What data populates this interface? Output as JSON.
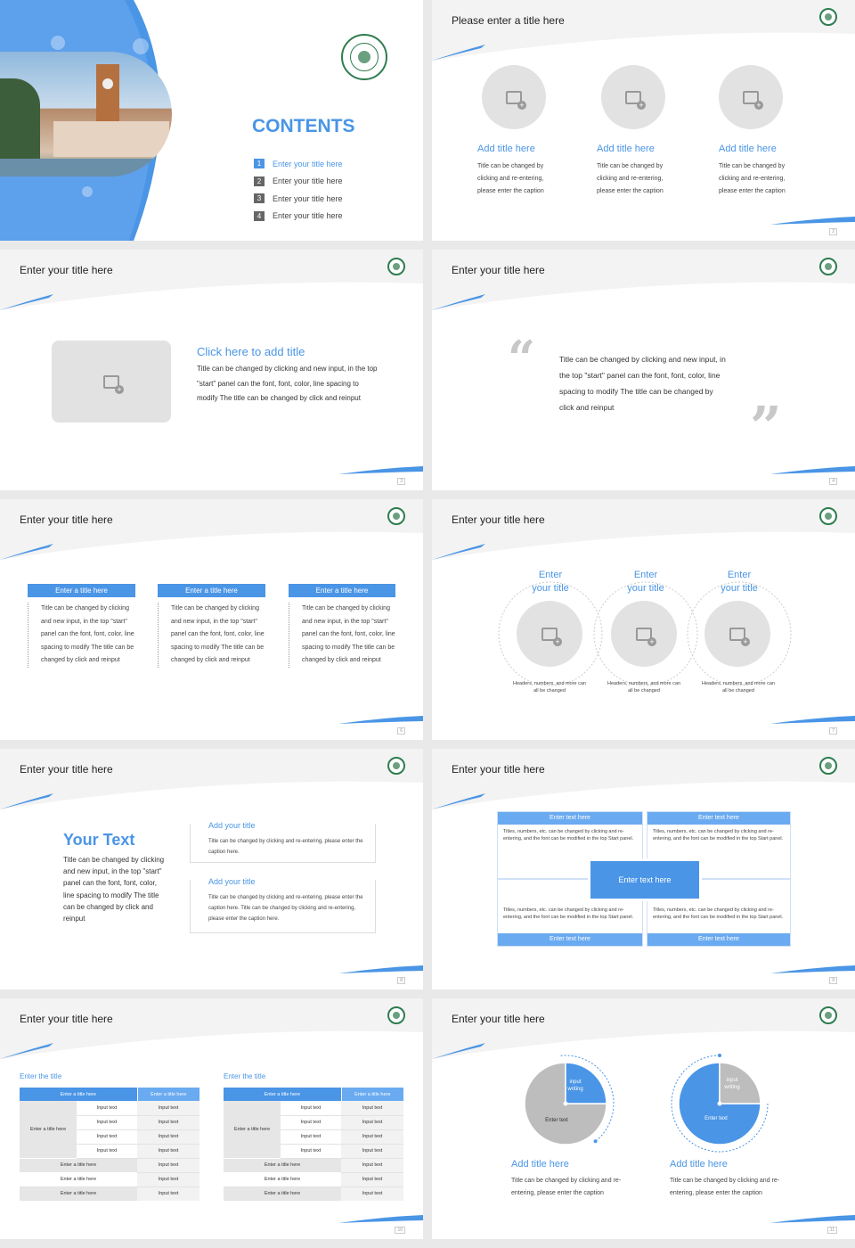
{
  "colors": {
    "accent": "#4a95e6",
    "gray": "#e2e2e2",
    "header_bg": "#f3f3f3"
  },
  "s1": {
    "contents_title": "CONTENTS",
    "items": [
      {
        "num": "1",
        "label": "Enter your title here"
      },
      {
        "num": "2",
        "label": "Enter your title here"
      },
      {
        "num": "3",
        "label": "Enter your title here"
      },
      {
        "num": "4",
        "label": "Enter your title here"
      }
    ]
  },
  "s2": {
    "title": "Please enter a title here",
    "page": "2",
    "cards": [
      {
        "title": "Add title here",
        "caption": "Title can be changed by clicking and re-entering, please enter the caption"
      },
      {
        "title": "Add title here",
        "caption": "Title can be changed by clicking and re-entering, please enter the caption"
      },
      {
        "title": "Add title here",
        "caption": "Title can be changed by clicking and re-entering, please enter the caption"
      }
    ]
  },
  "s3": {
    "title": "Enter your title here",
    "page": "3",
    "heading": "Click here to add title",
    "body": "Title can be changed by clicking and new input, in the top \"start\" panel can the font, font, color, line spacing to modify The title can be changed by click and reinput"
  },
  "s4": {
    "title": "Enter your title here",
    "page": "4",
    "quote": "Title can be changed by clicking and new input, in the top \"start\" panel can the font, font, color, line spacing to modify The title can be changed by click and reinput"
  },
  "s5": {
    "title": "Enter your title here",
    "page": "5",
    "boxes": [
      {
        "head": "Enter a title here",
        "body": "Title can be changed by clicking and new input, in the top \"start\" panel can the font, font, color, line spacing to modify The title can be changed by click and reinput"
      },
      {
        "head": "Enter a title here",
        "body": "Title can be changed by clicking and new input, in the top \"start\" panel can the font, font, color, line spacing to modify The title can be changed by click and reinput"
      },
      {
        "head": "Enter a title here",
        "body": "Title can be changed by clicking and new input, in the top \"start\" panel can the font, font, color, line spacing to modify The title can be changed by click and reinput"
      }
    ]
  },
  "s6": {
    "title": "Enter your title here",
    "page": "7",
    "circles": [
      {
        "line1": "Enter",
        "line2": "your title",
        "caption": "Headers, numbers, and more can all be changed"
      },
      {
        "line1": "Enter",
        "line2": "your title",
        "caption": "Headers, numbers, and more can all be changed"
      },
      {
        "line1": "Enter",
        "line2": "your title",
        "caption": "Headers, numbers, and more can all be changed"
      }
    ]
  },
  "s7": {
    "title": "Enter your title here",
    "page": "8",
    "big": "Your Text",
    "body": "Title can be changed by clicking and new input, in the top \"start\" panel can the font, font, color, line spacing to modify The title can be changed by click and reinput",
    "box1_title": "Add your title",
    "box1_text": "Title can be changed by clicking and re-entering, please enter the caption here.",
    "box2_title": "Add your title",
    "box2_text": "Title can be changed by clicking and re-entering, please enter the caption here. Title can be changed by clicking and re-entering, please enter the caption here."
  },
  "s8": {
    "title": "Enter your title here",
    "page": "9",
    "center": "Enter text here",
    "quads": [
      {
        "head": "Enter text here",
        "text": "Titles, numbers, etc. can be changed by clicking and re-entering, and the font can be modified in the top Start panel."
      },
      {
        "head": "Enter text here",
        "text": "Titles, numbers, etc. can be changed by clicking and re-entering, and the font can be modified in the top Start panel."
      },
      {
        "head": "Enter text here",
        "text": "Titles, numbers, etc. can be changed by clicking and re-entering, and the font can be modified in the top Start panel."
      },
      {
        "head": "Enter text here",
        "text": "Titles, numbers, etc. can be changed by clicking and re-entering, and the font can be modified in the top Start panel."
      }
    ]
  },
  "s9": {
    "title": "Enter your title here",
    "page": "10",
    "tables": [
      {
        "caption": "Enter the title",
        "h1": "Enter a title here",
        "h2": "Enter a title here",
        "group": "Enter a title here",
        "sub": "Input text",
        "cell": "Input text",
        "row": "Enter a title here"
      },
      {
        "caption": "Enter the title",
        "h1": "Enter a title here",
        "h2": "Enter a title here",
        "group": "Enter a title here",
        "sub": "Input text",
        "cell": "Input text",
        "row": "Enter a title here"
      }
    ]
  },
  "s10": {
    "title": "Enter your title here",
    "page": "11",
    "pies": [
      {
        "slice_label": "input writing",
        "rest_label": "Enter text",
        "slice_fraction": 0.25,
        "title": "Add title here",
        "caption": "Title can be changed by clicking and re-entering, please enter the caption"
      },
      {
        "slice_label": "input writing",
        "rest_label": "Enter text",
        "slice_fraction": 0.25,
        "title": "Add title here",
        "caption": "Title can be changed by clicking and re-entering, please enter the caption"
      }
    ]
  }
}
